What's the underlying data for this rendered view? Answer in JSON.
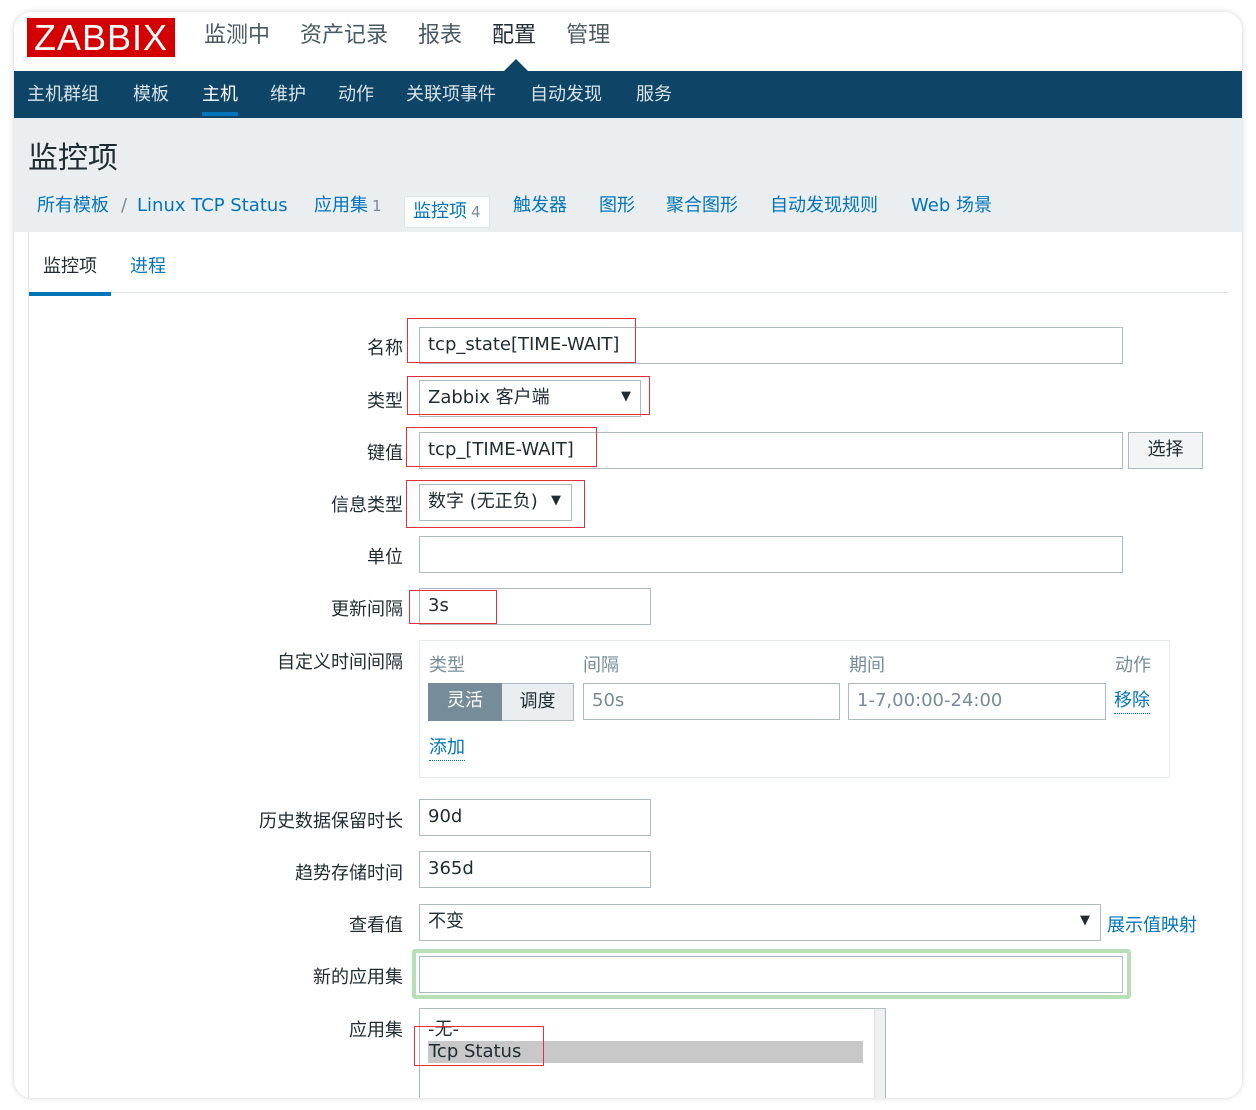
{
  "logo": "ZABBIX",
  "main_menu": [
    "监测中",
    "资产记录",
    "报表",
    "配置",
    "管理"
  ],
  "main_menu_active": "配置",
  "sub_menu": [
    "主机群组",
    "模板",
    "主机",
    "维护",
    "动作",
    "关联项事件",
    "自动发现",
    "服务"
  ],
  "sub_menu_active": "主机",
  "page_title": "监控项",
  "breadcrumbs": {
    "all_templates": "所有模板",
    "separator": "/",
    "template": "Linux TCP Status",
    "applications": "应用集",
    "applications_count": "1",
    "items": "监控项",
    "items_count": "4",
    "triggers": "触发器",
    "graphs": "图形",
    "screens": "聚合图形",
    "discovery": "自动发现规则",
    "web": "Web 场景"
  },
  "tabs": [
    "监控项",
    "进程"
  ],
  "form": {
    "name_label": "名称",
    "name_value": "tcp_state[TIME-WAIT]",
    "type_label": "类型",
    "type_value": "Zabbix 客户端",
    "key_label": "键值",
    "key_value": "tcp_[TIME-WAIT]",
    "select_button": "选择",
    "info_type_label": "信息类型",
    "info_type_value": "数字 (无正负)",
    "units_label": "单位",
    "units_value": "",
    "update_label": "更新间隔",
    "update_value": "3s",
    "custom_label": "自定义时间间隔",
    "custom": {
      "col_type": "类型",
      "col_interval": "间隔",
      "col_period": "期间",
      "col_action": "动作",
      "flexible": "灵活",
      "scheduling": "调度",
      "interval_value": "50s",
      "period_value": "1-7,00:00-24:00",
      "remove": "移除",
      "add": "添加"
    },
    "history_label": "历史数据保留时长",
    "history_value": "90d",
    "trends_label": "趋势存储时间",
    "trends_value": "365d",
    "show_value_label": "查看值",
    "show_value_value": "不变",
    "value_mapping_link": "展示值映射",
    "new_app_label": "新的应用集",
    "new_app_value": "",
    "apps_label": "应用集",
    "apps_options": [
      "-无-",
      "Tcp Status"
    ]
  },
  "colors": {
    "brand_red": "#d40000",
    "nav_blue": "#0e4465",
    "link_blue": "#0275b8",
    "highlight_red": "#e5303a",
    "focus_green": "#b7e0b7"
  }
}
